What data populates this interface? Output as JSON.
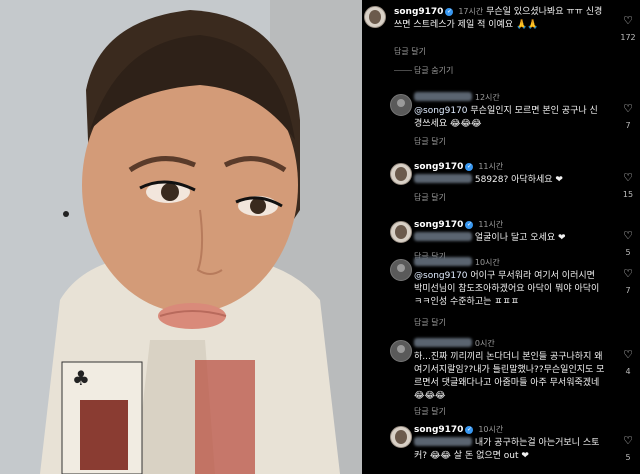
{
  "comments": [
    {
      "user": "song9170",
      "time": "17시간",
      "text": "무슨일 있으셨나봐요 ㅠㅠ 신경 쓰면 스트레스가 제일 적 이예요 🙏🙏",
      "reply_label": "답글 달기",
      "likes": "172"
    },
    {
      "hide_replies": "답글 숨기기"
    },
    {
      "user": "",
      "time": "12시간",
      "mention": "@song9170",
      "text": "무슨일인지 모르면 본인 공구나 신경쓰세요 😂😂😂",
      "reply_label": "답글 달기",
      "likes": "7"
    },
    {
      "user": "song9170",
      "time": "11시간",
      "text": "58928? 아닥하세요 ❤",
      "reply_label": "답글 달기",
      "likes": "15"
    },
    {
      "user": "song9170",
      "time": "11시간",
      "text": "얼굴이나 달고 오세요 ❤",
      "reply_label": "답글 달기",
      "likes": "5"
    },
    {
      "user": "",
      "time": "10시간",
      "mention": "@song9170",
      "text": "어이구 무서워라 여기서 이러시면 박미선님이 참도조아하겠어요 아닥이 뭐야 아닥이ㅋㅋ인성 수준하고는 ㅍㅍㅍ",
      "reply_label": "답글 달기",
      "likes": "7"
    },
    {
      "user": "",
      "time": "0시간",
      "text": "하...진짜 끼리끼리 논다더니 본인들 공구나하지 왜 여기서지랄임??내가 틀린말했나??무슨일인지도 모르면서 댓글왜다나고 아줌마들 아주 무서워죽겠네 😂😂😂",
      "reply_label": "답글 달기",
      "likes": "4"
    },
    {
      "user": "song9170",
      "time": "10시간",
      "text": "내가 공구하는걸 아는거보니 스토커? 😂😂 살 돈 없으면 out ❤",
      "likes": "5"
    }
  ],
  "icons": {
    "heart": "heart-icon",
    "verified": "verified-badge-icon",
    "avatar": "avatar"
  },
  "colors": {
    "background": "#000000",
    "text": "#ffffff",
    "secondary": "#9a9a9a",
    "verified": "#3897f0"
  }
}
